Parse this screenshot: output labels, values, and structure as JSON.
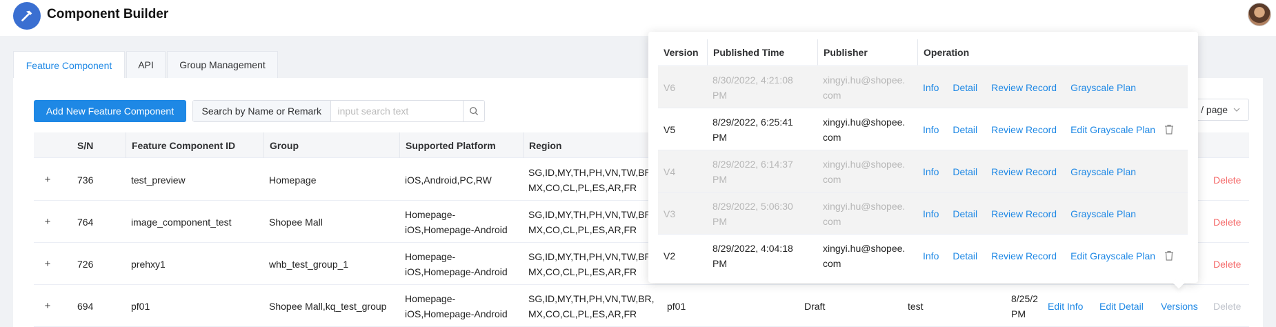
{
  "app": {
    "title": "Component Builder"
  },
  "tabs": [
    {
      "label": "Feature Component",
      "active": true
    },
    {
      "label": "API",
      "active": false
    },
    {
      "label": "Group Management",
      "active": false
    }
  ],
  "toolbar": {
    "add_label": "Add New Feature Component",
    "search_label": "Search by Name or Remark",
    "search_placeholder": "input search text",
    "page_size_label": "/ page"
  },
  "table": {
    "columns": [
      "S/N",
      "Feature Component ID",
      "Group",
      "Supported Platform",
      "Region"
    ],
    "rows": [
      {
        "sn": "736",
        "id": "test_preview",
        "group": "Homepage",
        "platform_1": "iOS,Android,PC,RW",
        "platform_2": "",
        "region_1": "SG,ID,MY,TH,PH,VN,TW,BR,",
        "region_2": "MX,CO,CL,PL,ES,AR,FR",
        "name": "",
        "status": "",
        "creator": "",
        "updated_1": "",
        "updated_2": "",
        "edit_info": "",
        "edit_detail": "",
        "versions": "",
        "delete": "Delete",
        "delete_enabled": true
      },
      {
        "sn": "764",
        "id": "image_component_test",
        "group": "Shopee Mall",
        "platform_1": "Homepage-",
        "platform_2": "iOS,Homepage-Android",
        "region_1": "SG,ID,MY,TH,PH,VN,TW,BR,",
        "region_2": "MX,CO,CL,PL,ES,AR,FR",
        "name": "",
        "status": "",
        "creator": "",
        "updated_1": "",
        "updated_2": "",
        "edit_info": "",
        "edit_detail": "",
        "versions": "",
        "delete": "Delete",
        "delete_enabled": true
      },
      {
        "sn": "726",
        "id": "prehxy1",
        "group": "whb_test_group_1",
        "platform_1": "Homepage-",
        "platform_2": "iOS,Homepage-Android",
        "region_1": "SG,ID,MY,TH,PH,VN,TW,BR,",
        "region_2": "MX,CO,CL,PL,ES,AR,FR",
        "name": "",
        "status": "",
        "creator": "",
        "updated_1": "",
        "updated_2": "",
        "edit_info": "",
        "edit_detail": "",
        "versions": "",
        "delete": "Delete",
        "delete_enabled": true
      },
      {
        "sn": "694",
        "id": "pf01",
        "group": "Shopee Mall,kq_test_group",
        "platform_1": "Homepage-",
        "platform_2": "iOS,Homepage-Android",
        "region_1": "SG,ID,MY,TH,PH,VN,TW,BR,",
        "region_2": "MX,CO,CL,PL,ES,AR,FR",
        "name": "pf01",
        "status": "Draft",
        "creator": "test",
        "updated_1": "8/25/2",
        "updated_2": "PM",
        "edit_info": "Edit Info",
        "edit_detail": "Edit Detail",
        "versions": "Versions",
        "delete": "Delete",
        "delete_enabled": false
      }
    ]
  },
  "versions_popover": {
    "columns": [
      "Version",
      "Published Time",
      "Publisher",
      "Operation"
    ],
    "rows": [
      {
        "version": "V6",
        "time_1": "8/30/2022, 4:21:08",
        "time_2": "PM",
        "publisher_1": "xingyi.hu@shopee.",
        "publisher_2": "com",
        "ops": [
          "Info",
          "Detail",
          "Review Record",
          "Grayscale Plan"
        ],
        "deletable": false,
        "style": "grey"
      },
      {
        "version": "V5",
        "time_1": "8/29/2022, 6:25:41",
        "time_2": "PM",
        "publisher_1": "xingyi.hu@shopee.",
        "publisher_2": "com",
        "ops": [
          "Info",
          "Detail",
          "Review Record",
          "Edit Grayscale Plan"
        ],
        "deletable": true,
        "style": "white"
      },
      {
        "version": "V4",
        "time_1": "8/29/2022, 6:14:37",
        "time_2": "PM",
        "publisher_1": "xingyi.hu@shopee.",
        "publisher_2": "com",
        "ops": [
          "Info",
          "Detail",
          "Review Record",
          "Grayscale Plan"
        ],
        "deletable": false,
        "style": "grey"
      },
      {
        "version": "V3",
        "time_1": "8/29/2022, 5:06:30",
        "time_2": "PM",
        "publisher_1": "xingyi.hu@shopee.",
        "publisher_2": "com",
        "ops": [
          "Info",
          "Detail",
          "Review Record",
          "Grayscale Plan"
        ],
        "deletable": false,
        "style": "grey"
      },
      {
        "version": "V2",
        "time_1": "8/29/2022, 4:04:18",
        "time_2": "PM",
        "publisher_1": "xingyi.hu@shopee.",
        "publisher_2": "com",
        "ops": [
          "Info",
          "Detail",
          "Review Record",
          "Edit Grayscale Plan"
        ],
        "deletable": true,
        "style": "white"
      }
    ]
  },
  "colors": {
    "primary": "#1e88e5",
    "danger": "#f56c6c",
    "disabled": "#c0c4cc",
    "logo": "#3a6fd1"
  },
  "icons": {
    "logo": "hammer-icon",
    "search": "search-icon",
    "dropdown": "chevron-down-icon",
    "delete": "trash-icon"
  }
}
